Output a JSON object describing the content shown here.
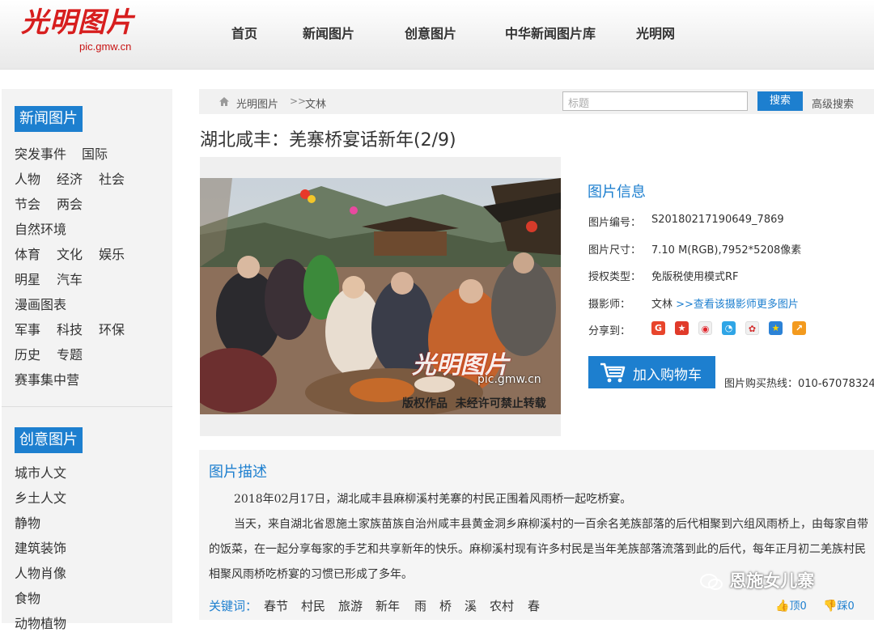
{
  "header": {
    "logo_text": "光明图片",
    "logo_url": "pic.gmw.cn",
    "nav": [
      "首页",
      "新闻图片",
      "创意图片",
      "中华新闻图片库",
      "光明网"
    ]
  },
  "sidebar": {
    "news_title": "新闻图片",
    "news_links": [
      "突发事件",
      "国际",
      "人物",
      "经济",
      "社会",
      "节会",
      "两会",
      "自然环境",
      "体育",
      "文化",
      "娱乐",
      "明星",
      "汽车",
      "漫画图表",
      "军事",
      "科技",
      "环保",
      "历史",
      "专题",
      "赛事集中营"
    ],
    "creative_title": "创意图片",
    "creative_links": [
      "城市人文",
      "乡土人文",
      "静物",
      "建筑装饰",
      "人物肖像",
      "食物",
      "动物植物"
    ]
  },
  "breadcrumb": {
    "home": "光明图片",
    "separator": ">>",
    "current": "文林"
  },
  "search": {
    "placeholder": "标题",
    "button": "搜索",
    "advanced": "高级搜索"
  },
  "page_title": "湖北咸丰：羌寨桥宴话新年(2/9)",
  "photo": {
    "watermark_logo": "光明图片",
    "watermark_url": "pic.gmw.cn",
    "copyright_notice": "版权作品  未经许可禁止转载"
  },
  "info": {
    "title": "图片信息",
    "id_label": "图片编号：",
    "id_value": "S20180217190649_7869",
    "size_label": "图片尺寸：",
    "size_value": "7.10 M(RGB),7952*5208像素",
    "license_label": "授权类型：",
    "license_value": "免版税使用模式RF",
    "photographer_label": "摄影师：",
    "photographer_value": "文林",
    "photographer_link": " >>查看该摄影师更多图片",
    "share_label": "分享到：",
    "share_icons": [
      "share-icon-1",
      "share-icon-2",
      "share-icon-3",
      "share-icon-4",
      "share-icon-5",
      "share-icon-6",
      "share-icon-7"
    ],
    "cart_button": "加入购物车",
    "hotline": "图片购买热线：010-67078324"
  },
  "description": {
    "title": "图片描述",
    "p1": "2018年02月17日，湖北咸丰县麻柳溪村羌寨的村民正围着风雨桥一起吃桥宴。",
    "p2": "当天，来自湖北省恩施土家族苗族自治州咸丰县黄金洞乡麻柳溪村的一百余名羌族部落的后代相聚到六组风雨桥上，由每家自带的饭菜，在一起分享每家的手艺和共享新年的快乐。麻柳溪村现有许多村民是当年羌族部落流落到此的后代，每年正月初二羌族村民相聚风雨桥吃桥宴的习惯已形成了多年。",
    "keywords_label": "关键词：",
    "keywords": [
      "春节",
      "村民",
      "旅游",
      "新年",
      "雨",
      "桥",
      "溪",
      "农村",
      "春"
    ]
  },
  "votes": {
    "up": "顶0",
    "down": "踩0"
  },
  "overlay_watermark": "恩施女儿寨"
}
